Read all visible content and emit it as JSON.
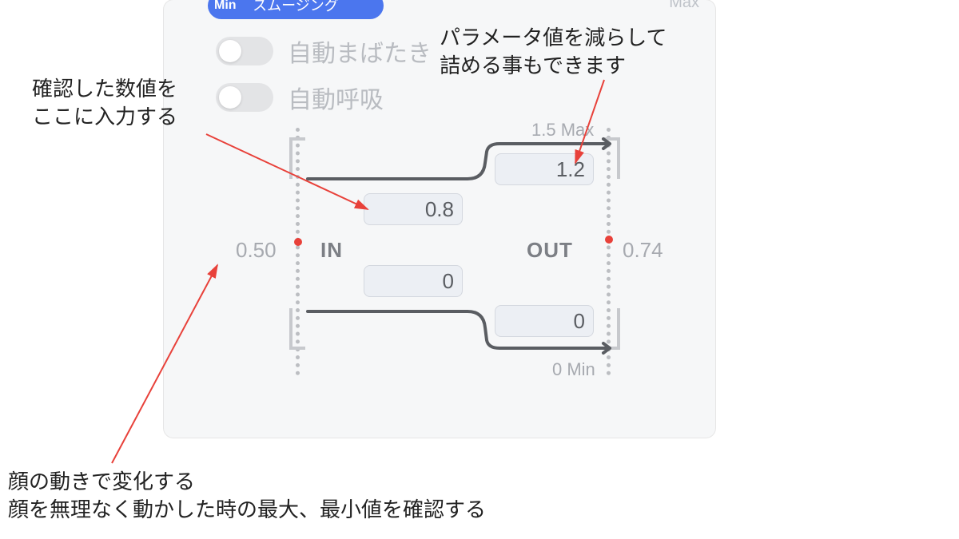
{
  "header": {
    "pill_label": "スムージング",
    "pill_min": "Min",
    "max_label": "Max"
  },
  "toggles": {
    "blink_label": "自動まばたき",
    "breath_label": "自動呼吸"
  },
  "curve": {
    "in_label": "IN",
    "out_label": "OUT",
    "in_value": "0.50",
    "out_value": "0.74",
    "max_line": "1.5 Max",
    "min_line": "0 Min",
    "in_top": "0.8",
    "out_top": "1.2",
    "in_bot": "0",
    "out_bot": "0"
  },
  "annotations": {
    "a1": "確認した数値を\nここに入力する",
    "a2": "パラメータ値を減らして\n詰める事もできます",
    "a3": "顔の動きで変化する\n顔を無理なく動かした時の最大、最小値を確認する"
  }
}
